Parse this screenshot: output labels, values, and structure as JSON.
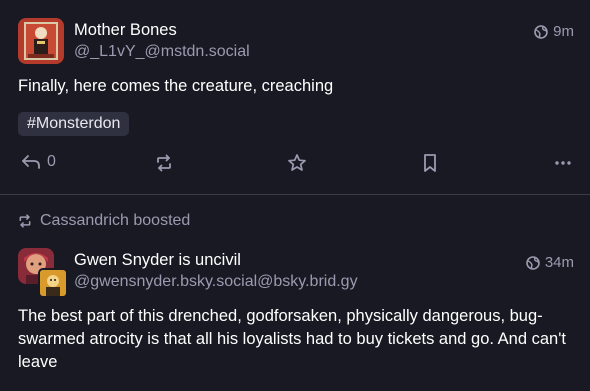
{
  "posts": [
    {
      "author_name": "Mother Bones",
      "author_handle": "@_L1vY_@mstdn.social",
      "time": "9m",
      "content": "Finally, here comes the creature, creaching",
      "hashtag": "#Monsterdon",
      "reply_count": "0",
      "visibility_icon": "globe-icon"
    },
    {
      "boosted_by": "Cassandrich boosted",
      "author_name": "Gwen Snyder is uncivil",
      "author_handle": "@gwensnyder.bsky.social@bsky.brid.gy",
      "time": "34m",
      "content": "The best part of this drenched, godforsaken, physically dangerous, bug-swarmed atrocity is that all his loyalists had to buy tickets and go. And can't leave",
      "visibility_icon": "globe-icon"
    }
  ],
  "colors": {
    "background": "#181922",
    "muted_text": "#9a9bb0",
    "hashtag_bg": "#2f3040",
    "divider": "#3a3b48"
  }
}
